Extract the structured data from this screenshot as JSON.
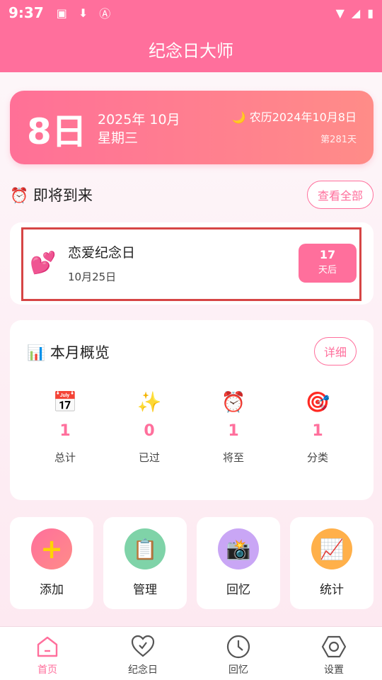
{
  "status_bar": {
    "time": "9:37"
  },
  "app_title": "纪念日大师",
  "date_card": {
    "day": "8日",
    "year_month": "2025年 10月",
    "weekday": "星期三",
    "lunar": "🌙 农历2024年10月8日",
    "day_of_year": "第281天"
  },
  "upcoming": {
    "title": "⏰ 即将到来",
    "view_all": "查看全部",
    "items": [
      {
        "name": "恋爱纪念日",
        "date": "10月25日",
        "days": "17",
        "unit": "天后"
      }
    ]
  },
  "overview": {
    "title": "📊 本月概览",
    "detail": "详细",
    "stats": [
      {
        "icon": "📅",
        "value": "1",
        "label": "总计"
      },
      {
        "icon": "✨",
        "value": "0",
        "label": "已过"
      },
      {
        "icon": "⏰",
        "value": "1",
        "label": "将至"
      },
      {
        "icon": "🎯",
        "value": "1",
        "label": "分类"
      }
    ]
  },
  "actions": [
    {
      "icon": "➕",
      "label": "添加",
      "color": "#ff7a93"
    },
    {
      "icon": "📋",
      "label": "管理",
      "color": "#7fd3a8"
    },
    {
      "icon": "📸",
      "label": "回忆",
      "color": "#c9a6f5"
    },
    {
      "icon": "📈",
      "label": "统计",
      "color": "#ffb04a"
    }
  ],
  "nav": [
    {
      "label": "首页",
      "icon": "home-icon"
    },
    {
      "label": "纪念日",
      "icon": "heart-icon"
    },
    {
      "label": "回忆",
      "icon": "clock-icon"
    },
    {
      "label": "设置",
      "icon": "settings-icon"
    }
  ],
  "colors": {
    "accent": "#ff6f9c",
    "highlight_border": "#d64545"
  }
}
